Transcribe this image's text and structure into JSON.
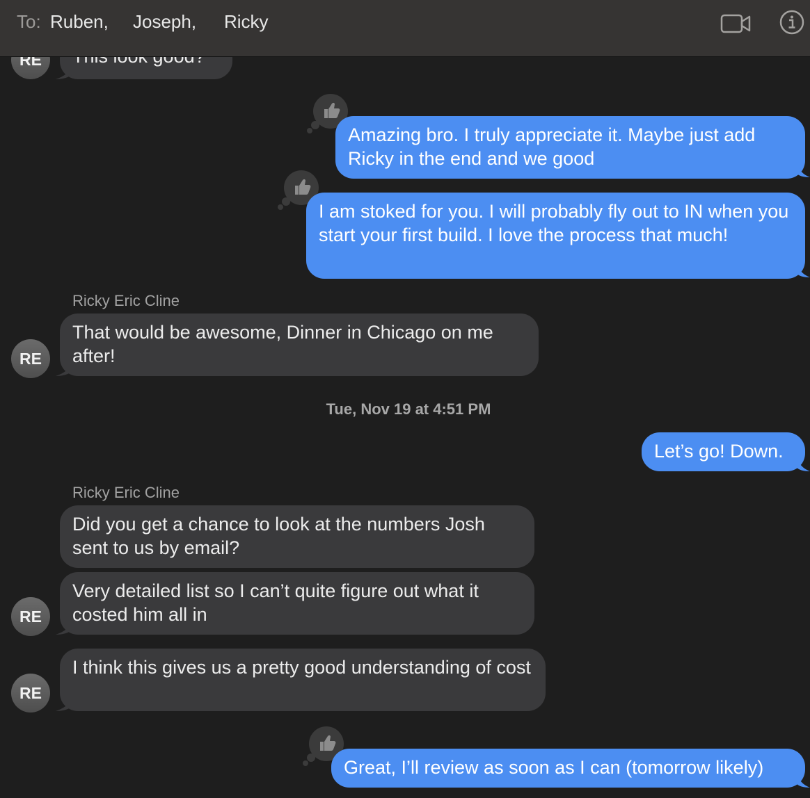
{
  "header": {
    "to_label": "To:",
    "recipients": [
      "Ruben,",
      "Joseph,",
      "Ricky"
    ],
    "video_icon": "video-camera-icon",
    "info_icon": "info-icon"
  },
  "colors": {
    "outgoing_bubble": "#4c8ef2",
    "incoming_bubble": "#3a3a3c",
    "background": "#1e1e1e",
    "header": "#363433"
  },
  "messages": [
    {
      "direction": "in",
      "text": "This look good?",
      "avatar": "RE"
    },
    {
      "direction": "out",
      "text": "Amazing bro. I truly appreciate it. Maybe just add Ricky in the end and we good",
      "reaction": "thumbs-up-icon"
    },
    {
      "direction": "out",
      "text": "I am stoked for you. I will probably fly out to IN when you start your first build. I love the process that much!",
      "reaction": "thumbs-up-icon"
    },
    {
      "direction": "in",
      "sender": "Ricky Eric Cline",
      "text": "That would be awesome, Dinner in Chicago on me after!",
      "avatar": "RE"
    },
    {
      "type": "timestamp",
      "text": "Tue, Nov 19 at 4:51 PM"
    },
    {
      "direction": "out",
      "text": "Let’s go! Down."
    },
    {
      "direction": "in",
      "sender": "Ricky Eric Cline",
      "text": "Did you get a chance to look at the numbers Josh sent to us by email?"
    },
    {
      "direction": "in",
      "text": "Very detailed list so I can’t quite figure out what it costed him all in",
      "avatar": "RE"
    },
    {
      "direction": "in",
      "text": "I think this gives us a pretty good understanding of cost",
      "avatar": "RE"
    },
    {
      "direction": "out",
      "text": "Great, I’ll review as soon as I can (tomorrow likely)",
      "reaction": "thumbs-up-icon"
    }
  ]
}
